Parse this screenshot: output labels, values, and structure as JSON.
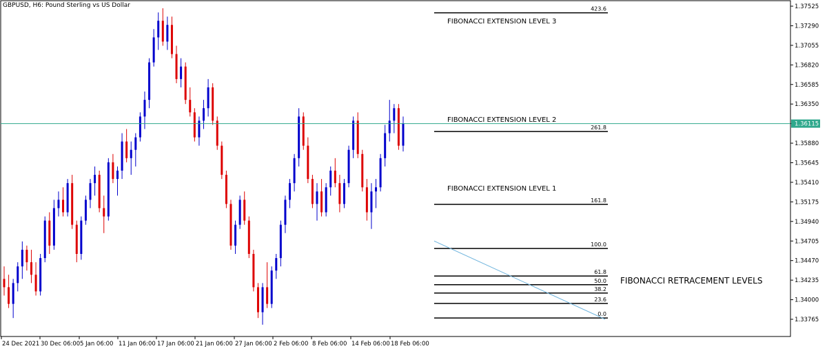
{
  "header": {
    "title": "GBPUSD, H6:  Pound Sterling vs US Dollar"
  },
  "chart_data": {
    "type": "candlestick",
    "symbol": "GBPUSD",
    "timeframe": "H6",
    "instrument_name": "Pound Sterling vs US Dollar",
    "ylim": [
      1.3365,
      1.376
    ],
    "y_ticks": [
      "1.37525",
      "1.37290",
      "1.37055",
      "1.36820",
      "1.36585",
      "1.36350",
      "1.36115",
      "1.35880",
      "1.35645",
      "1.35410",
      "1.35175",
      "1.34940",
      "1.34705",
      "1.34470",
      "1.34235",
      "1.34000",
      "1.33765"
    ],
    "x_ticks": [
      "24 Dec 2021",
      "30 Dec 06:00",
      "5 Jan 06:00",
      "11 Jan 06:00",
      "17 Jan 06:00",
      "21 Jan 06:00",
      "27 Jan 06:00",
      "2 Feb 06:00",
      "8 Feb 06:00",
      "14 Feb 06:00",
      "18 Feb 06:00"
    ],
    "current_price": "1.36115",
    "colors": {
      "up": "#0000cc",
      "down": "#dd0000",
      "bid_line": "#2fa88c",
      "trend_line": "#6fb4dd",
      "price_tag": "#2fa88c"
    },
    "candles": [
      [
        1.3425,
        1.344,
        1.3405,
        1.3415
      ],
      [
        1.3415,
        1.343,
        1.339,
        1.3395
      ],
      [
        1.3395,
        1.3425,
        1.3378,
        1.342
      ],
      [
        1.342,
        1.3445,
        1.341,
        1.344
      ],
      [
        1.344,
        1.347,
        1.3425,
        1.346
      ],
      [
        1.346,
        1.3465,
        1.3435,
        1.3445
      ],
      [
        1.3445,
        1.346,
        1.342,
        1.343
      ],
      [
        1.343,
        1.3445,
        1.3405,
        1.341
      ],
      [
        1.341,
        1.3455,
        1.3405,
        1.345
      ],
      [
        1.345,
        1.35,
        1.3445,
        1.3495
      ],
      [
        1.3495,
        1.3505,
        1.3455,
        1.3465
      ],
      [
        1.3465,
        1.352,
        1.346,
        1.351
      ],
      [
        1.351,
        1.353,
        1.35,
        1.352
      ],
      [
        1.352,
        1.3535,
        1.35,
        1.3505
      ],
      [
        1.3505,
        1.3545,
        1.35,
        1.354
      ],
      [
        1.354,
        1.355,
        1.3485,
        1.349
      ],
      [
        1.349,
        1.3495,
        1.3445,
        1.3455
      ],
      [
        1.3455,
        1.35,
        1.3448,
        1.3495
      ],
      [
        1.3495,
        1.3525,
        1.349,
        1.352
      ],
      [
        1.352,
        1.3545,
        1.351,
        1.354
      ],
      [
        1.354,
        1.356,
        1.3525,
        1.355
      ],
      [
        1.355,
        1.3555,
        1.3505,
        1.351
      ],
      [
        1.351,
        1.3525,
        1.348,
        1.35
      ],
      [
        1.35,
        1.357,
        1.3495,
        1.3565
      ],
      [
        1.3565,
        1.3575,
        1.354,
        1.3545
      ],
      [
        1.3545,
        1.356,
        1.3525,
        1.3555
      ],
      [
        1.3555,
        1.36,
        1.3545,
        1.359
      ],
      [
        1.359,
        1.3605,
        1.3565,
        1.357
      ],
      [
        1.357,
        1.359,
        1.355,
        1.358
      ],
      [
        1.358,
        1.36,
        1.356,
        1.3595
      ],
      [
        1.3595,
        1.3625,
        1.359,
        1.362
      ],
      [
        1.362,
        1.365,
        1.3605,
        1.364
      ],
      [
        1.364,
        1.369,
        1.363,
        1.3685
      ],
      [
        1.3685,
        1.3725,
        1.368,
        1.3715
      ],
      [
        1.3715,
        1.3745,
        1.37,
        1.3735
      ],
      [
        1.3735,
        1.375,
        1.3705,
        1.371
      ],
      [
        1.371,
        1.374,
        1.37,
        1.373
      ],
      [
        1.373,
        1.374,
        1.369,
        1.3695
      ],
      [
        1.3695,
        1.3705,
        1.366,
        1.3665
      ],
      [
        1.3665,
        1.369,
        1.3655,
        1.368
      ],
      [
        1.368,
        1.3685,
        1.3635,
        1.364
      ],
      [
        1.364,
        1.3655,
        1.362,
        1.3625
      ],
      [
        1.3625,
        1.363,
        1.359,
        1.3595
      ],
      [
        1.3595,
        1.362,
        1.3585,
        1.3615
      ],
      [
        1.3615,
        1.364,
        1.3605,
        1.363
      ],
      [
        1.363,
        1.3665,
        1.362,
        1.3655
      ],
      [
        1.3655,
        1.366,
        1.361,
        1.3615
      ],
      [
        1.3615,
        1.362,
        1.358,
        1.3585
      ],
      [
        1.3585,
        1.359,
        1.3545,
        1.355
      ],
      [
        1.355,
        1.3555,
        1.351,
        1.3515
      ],
      [
        1.3515,
        1.352,
        1.346,
        1.3465
      ],
      [
        1.3465,
        1.3495,
        1.3455,
        1.349
      ],
      [
        1.349,
        1.3525,
        1.3485,
        1.352
      ],
      [
        1.352,
        1.353,
        1.349,
        1.3495
      ],
      [
        1.3495,
        1.35,
        1.345,
        1.3455
      ],
      [
        1.3455,
        1.346,
        1.341,
        1.3415
      ],
      [
        1.3415,
        1.342,
        1.3378,
        1.3385
      ],
      [
        1.3385,
        1.342,
        1.337,
        1.3415
      ],
      [
        1.3415,
        1.3445,
        1.339,
        1.3395
      ],
      [
        1.3395,
        1.344,
        1.339,
        1.3435
      ],
      [
        1.3435,
        1.3455,
        1.3425,
        1.345
      ],
      [
        1.345,
        1.3495,
        1.344,
        1.349
      ],
      [
        1.349,
        1.3525,
        1.348,
        1.352
      ],
      [
        1.352,
        1.3545,
        1.351,
        1.354
      ],
      [
        1.354,
        1.3575,
        1.353,
        1.357
      ],
      [
        1.357,
        1.363,
        1.356,
        1.362
      ],
      [
        1.362,
        1.3625,
        1.358,
        1.3585
      ],
      [
        1.3585,
        1.3595,
        1.354,
        1.3545
      ],
      [
        1.3545,
        1.355,
        1.351,
        1.3515
      ],
      [
        1.3515,
        1.354,
        1.3495,
        1.353
      ],
      [
        1.353,
        1.3545,
        1.35,
        1.3505
      ],
      [
        1.3505,
        1.354,
        1.35,
        1.3535
      ],
      [
        1.3535,
        1.356,
        1.3525,
        1.3555
      ],
      [
        1.3555,
        1.357,
        1.3535,
        1.354
      ],
      [
        1.354,
        1.355,
        1.3505,
        1.3515
      ],
      [
        1.3515,
        1.3545,
        1.351,
        1.354
      ],
      [
        1.354,
        1.3585,
        1.3535,
        1.358
      ],
      [
        1.358,
        1.362,
        1.357,
        1.3615
      ],
      [
        1.3615,
        1.3625,
        1.357,
        1.3575
      ],
      [
        1.3575,
        1.358,
        1.353,
        1.3535
      ],
      [
        1.3535,
        1.3545,
        1.3495,
        1.3505
      ],
      [
        1.3505,
        1.354,
        1.3485,
        1.353
      ],
      [
        1.353,
        1.3545,
        1.351,
        1.3535
      ],
      [
        1.3535,
        1.3575,
        1.353,
        1.357
      ],
      [
        1.357,
        1.361,
        1.356,
        1.36
      ],
      [
        1.36,
        1.364,
        1.359,
        1.3615
      ],
      [
        1.3615,
        1.3635,
        1.36,
        1.363
      ],
      [
        1.363,
        1.3635,
        1.358,
        1.3585
      ],
      [
        1.3585,
        1.362,
        1.3578,
        1.3612
      ]
    ],
    "trend_line": {
      "from_price": 1.34705,
      "to_price": 1.33765,
      "color": "#6fb4dd"
    }
  },
  "fibonacci": {
    "extension_labels": [
      "FIBONACCI EXTENSION LEVEL 3",
      "FIBONACCI EXTENSION LEVEL 2",
      "FIBONACCI EXTENSION LEVEL 1"
    ],
    "retracement_label": "FIBONACCI RETRACEMENT LEVELS",
    "levels": [
      {
        "label": "423.6",
        "price": 1.37445
      },
      {
        "label": "261.8",
        "price": 1.3602
      },
      {
        "label": "161.8",
        "price": 1.35145
      },
      {
        "label": "100.0",
        "price": 1.34615
      },
      {
        "label": "61.8",
        "price": 1.34285
      },
      {
        "label": "50.0",
        "price": 1.3418
      },
      {
        "label": "38.2",
        "price": 1.3408
      },
      {
        "label": "23.6",
        "price": 1.33955
      },
      {
        "label": "0.0",
        "price": 1.3378
      }
    ]
  }
}
